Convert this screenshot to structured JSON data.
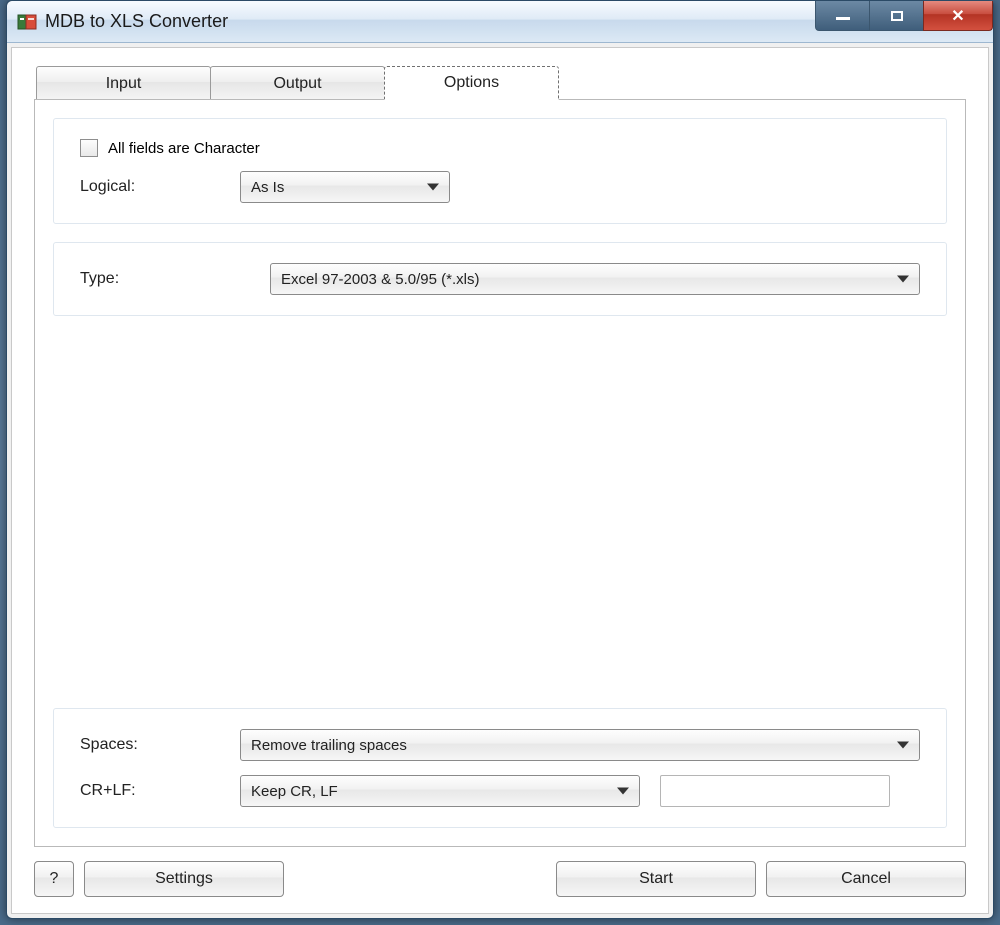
{
  "window": {
    "title": "MDB to XLS Converter"
  },
  "tabs": {
    "input": "Input",
    "output": "Output",
    "options": "Options",
    "active": "options"
  },
  "options": {
    "all_fields_char_label": "All fields are Character",
    "all_fields_char_checked": false,
    "logical_label": "Logical:",
    "logical_value": "As Is",
    "type_label": "Type:",
    "type_value": "Excel 97-2003 & 5.0/95 (*.xls)",
    "spaces_label": "Spaces:",
    "spaces_value": "Remove trailing spaces",
    "crlf_label": "CR+LF:",
    "crlf_value": "Keep CR, LF",
    "crlf_extra_value": ""
  },
  "buttons": {
    "help": "?",
    "settings": "Settings",
    "start": "Start",
    "cancel": "Cancel"
  }
}
